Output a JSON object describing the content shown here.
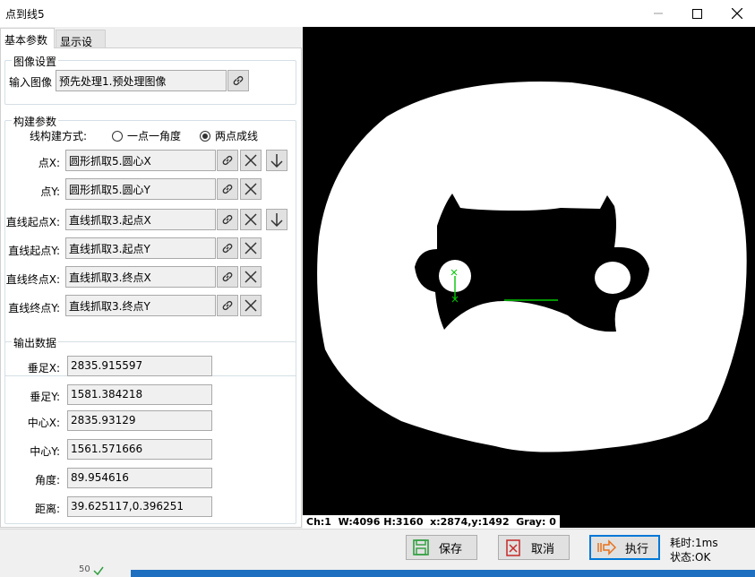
{
  "window": {
    "title": "点到线5"
  },
  "tabs": [
    "基本参数",
    "显示设置"
  ],
  "image_settings": {
    "title": "图像设置",
    "input_label": "输入图像",
    "input_value": "预先处理1.预处理图像"
  },
  "build_params": {
    "title": "构建参数",
    "mode_label": "线构建方式:",
    "mode_options": [
      "一点一角度",
      "两点成线"
    ],
    "rows": [
      {
        "label": "点X:",
        "value": "圆形抓取5.圆心X"
      },
      {
        "label": "点Y:",
        "value": "圆形抓取5.圆心Y"
      },
      {
        "label": "直线起点X:",
        "value": "直线抓取3.起点X"
      },
      {
        "label": "直线起点Y:",
        "value": "直线抓取3.起点Y"
      },
      {
        "label": "直线终点X:",
        "value": "直线抓取3.终点X"
      },
      {
        "label": "直线终点Y:",
        "value": "直线抓取3.终点Y"
      }
    ]
  },
  "output": {
    "title": "输出数据",
    "rows": [
      {
        "label": "垂足X:",
        "value": "2835.915597"
      },
      {
        "label": "垂足Y:",
        "value": "1581.384218"
      },
      {
        "label": "中心X:",
        "value": "2835.93129"
      },
      {
        "label": "中心Y:",
        "value": "1561.571666"
      },
      {
        "label": "角度:",
        "value": "89.954616"
      },
      {
        "label": "距离:",
        "value": "39.625117,0.396251"
      }
    ]
  },
  "viewer_status": "Ch:1  W:4096 H:3160  x:2874,y:1492  Gray: 0",
  "actions": {
    "save": "保存",
    "cancel": "取消",
    "run": "执行"
  },
  "meta": {
    "time": "耗时:1ms",
    "state": "状态:OK"
  },
  "background_row": {
    "number": "50"
  },
  "colors": {
    "accent": "#0078d7",
    "save_icon": "#2e9e3e",
    "cancel_icon": "#c62828",
    "run_icon": "#e8711a",
    "marker": "#00c800"
  }
}
